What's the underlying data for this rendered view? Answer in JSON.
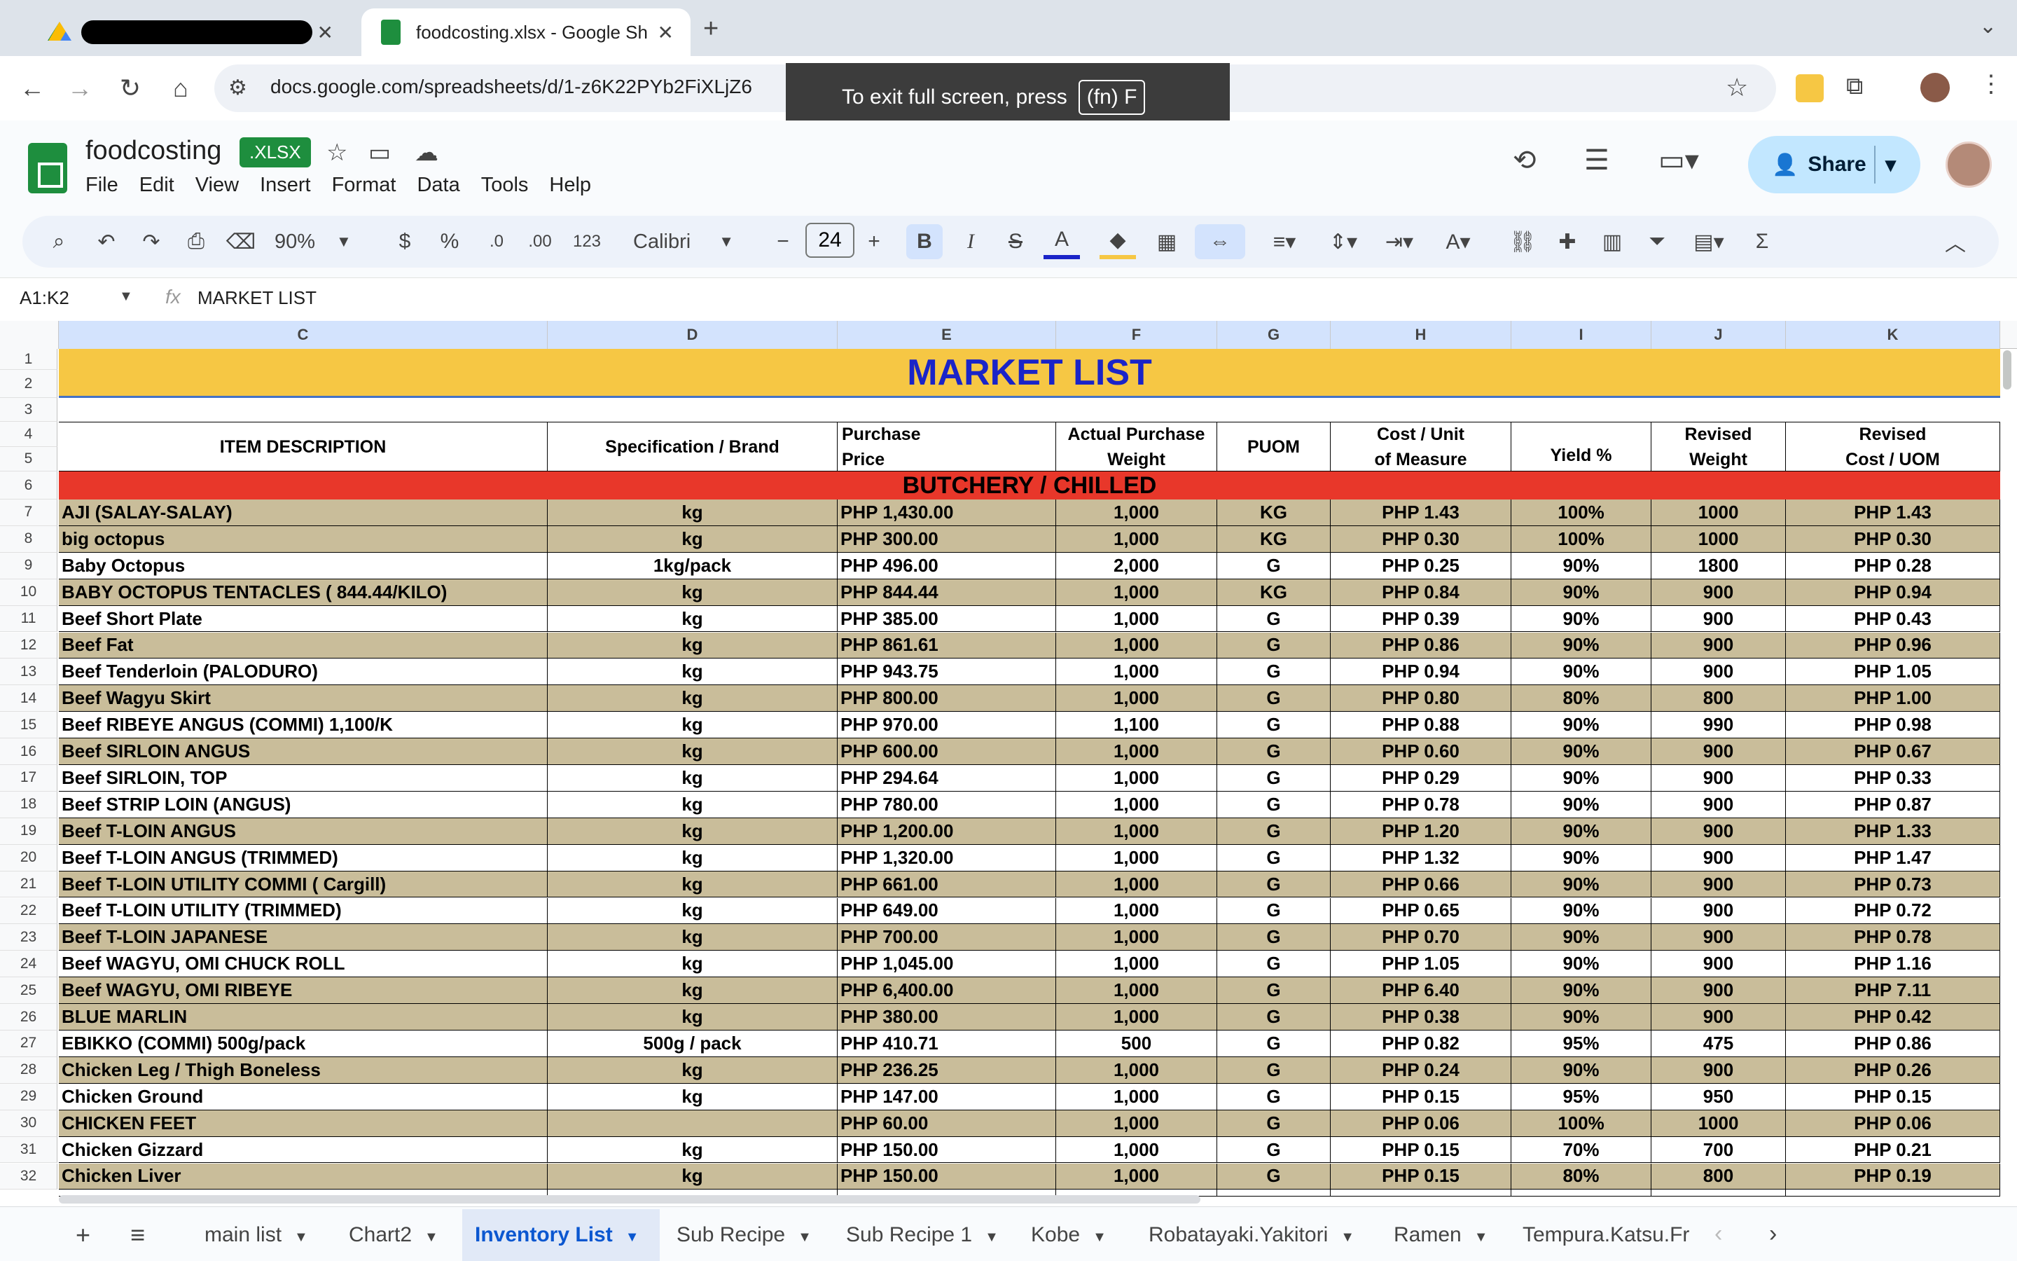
{
  "browser": {
    "tabs": [
      {
        "label": "",
        "redacted": true
      },
      {
        "label": "foodcosting.xlsx - Google Sh"
      }
    ],
    "url": "docs.google.com/spreadsheets/d/1-z6K22PYb2FiXLjZ6",
    "fullscreen_toast": {
      "text": "To exit full screen, press",
      "key": "(fn) F"
    }
  },
  "doc": {
    "title": "foodcosting",
    "badge": ".XLSX",
    "menu": [
      "File",
      "Edit",
      "View",
      "Insert",
      "Format",
      "Data",
      "Tools",
      "Help"
    ],
    "share_label": "Share"
  },
  "toolbar": {
    "zoom": "90%",
    "currency": "$",
    "percent": "%",
    "dec_decrease": ".0",
    "dec_increase": ".00",
    "number_format": "123",
    "font": "Calibri",
    "font_size": "24",
    "minus": "−",
    "plus": "+",
    "bold": "B",
    "italic": "I",
    "strike": "S",
    "textcolor": "A"
  },
  "formula_bar": {
    "namebox": "A1:K2",
    "fx": "fx",
    "content": "MARKET LIST"
  },
  "columns": [
    "C",
    "D",
    "E",
    "F",
    "G",
    "H",
    "I",
    "J",
    "K"
  ],
  "rows_visible": [
    "1",
    "2",
    "3",
    "4",
    "5",
    "6",
    "7",
    "8",
    "9",
    "10",
    "11",
    "12",
    "13",
    "14",
    "15",
    "16",
    "17",
    "18",
    "19",
    "20",
    "21",
    "22",
    "23",
    "24",
    "25",
    "26",
    "27",
    "28",
    "29",
    "30",
    "31",
    "32"
  ],
  "sheet": {
    "title": "MARKET LIST",
    "section": "BUTCHERY / CHILLED",
    "headers": {
      "c": "ITEM DESCRIPTION",
      "d": "Specification / Brand",
      "e1": "Purchase",
      "e2": "Price",
      "f1": "Actual Purchase",
      "f2": "Weight",
      "g": "PUOM",
      "h1": "Cost / Unit",
      "h2": "of Measure",
      "i": "Yield %",
      "j1": "Revised",
      "j2": "Weight",
      "k1": "Revised",
      "k2": "Cost / UOM"
    },
    "items": [
      {
        "row": "7",
        "desc": "AJI (SALAY-SALAY)",
        "spec": "kg",
        "price": "PHP 1,430.00",
        "weight": "1,000",
        "puom": "KG",
        "cost": "PHP 1.43",
        "yield": "100%",
        "rweight": "1000",
        "rcost": "PHP 1.43",
        "tan": true
      },
      {
        "row": "8",
        "desc": " big octopus",
        "spec": "kg",
        "price": "PHP 300.00",
        "weight": "1,000",
        "puom": "KG",
        "cost": "PHP 0.30",
        "yield": "100%",
        "rweight": "1000",
        "rcost": "PHP 0.30",
        "tan": true
      },
      {
        "row": "9",
        "desc": "Baby Octopus",
        "spec": "1kg/pack",
        "price": "PHP 496.00",
        "weight": "2,000",
        "puom": "G",
        "cost": "PHP 0.25",
        "yield": "90%",
        "rweight": "1800",
        "rcost": "PHP 0.28",
        "tan": false
      },
      {
        "row": "10",
        "desc": "BABY OCTOPUS  TENTACLES ( 844.44/KILO)",
        "spec": "kg",
        "price": "PHP 844.44",
        "weight": "1,000",
        "puom": "KG",
        "cost": "PHP 0.84",
        "yield": "90%",
        "rweight": "900",
        "rcost": "PHP 0.94",
        "tan": true
      },
      {
        "row": "11",
        "desc": "Beef Short Plate",
        "spec": "kg",
        "price": "PHP 385.00",
        "weight": "1,000",
        "puom": "G",
        "cost": "PHP 0.39",
        "yield": "90%",
        "rweight": "900",
        "rcost": "PHP 0.43",
        "tan": false
      },
      {
        "row": "12",
        "desc": "Beef Fat",
        "spec": "kg",
        "price": "PHP 861.61",
        "weight": "1,000",
        "puom": "G",
        "cost": "PHP 0.86",
        "yield": "90%",
        "rweight": "900",
        "rcost": "PHP 0.96",
        "tan": true
      },
      {
        "row": "13",
        "desc": "Beef Tenderloin (PALODURO)",
        "spec": "kg",
        "price": "PHP 943.75",
        "weight": "1,000",
        "puom": "G",
        "cost": "PHP 0.94",
        "yield": "90%",
        "rweight": "900",
        "rcost": "PHP 1.05",
        "tan": false
      },
      {
        "row": "14",
        "desc": "Beef Wagyu Skirt",
        "spec": "kg",
        "price": "PHP 800.00",
        "weight": "1,000",
        "puom": "G",
        "cost": "PHP 0.80",
        "yield": "80%",
        "rweight": "800",
        "rcost": "PHP 1.00",
        "tan": true
      },
      {
        "row": "15",
        "desc": "Beef RIBEYE ANGUS (COMMI) 1,100/K",
        "spec": "kg",
        "price": "PHP 970.00",
        "weight": "1,100",
        "puom": "G",
        "cost": "PHP 0.88",
        "yield": "90%",
        "rweight": "990",
        "rcost": "PHP 0.98",
        "tan": false
      },
      {
        "row": "16",
        "desc": "Beef SIRLOIN ANGUS",
        "spec": "kg",
        "price": "PHP 600.00",
        "weight": "1,000",
        "puom": "G",
        "cost": "PHP 0.60",
        "yield": "90%",
        "rweight": "900",
        "rcost": "PHP 0.67",
        "tan": true
      },
      {
        "row": "17",
        "desc": "Beef SIRLOIN, TOP",
        "spec": "kg",
        "price": "PHP 294.64",
        "weight": "1,000",
        "puom": "G",
        "cost": "PHP 0.29",
        "yield": "90%",
        "rweight": "900",
        "rcost": "PHP 0.33",
        "tan": false
      },
      {
        "row": "18",
        "desc": "Beef STRIP LOIN  (ANGUS)",
        "spec": "kg",
        "price": "PHP 780.00",
        "weight": "1,000",
        "puom": "G",
        "cost": "PHP 0.78",
        "yield": "90%",
        "rweight": "900",
        "rcost": "PHP 0.87",
        "tan": false
      },
      {
        "row": "19",
        "desc": "Beef T-LOIN ANGUS",
        "spec": "kg",
        "price": "PHP 1,200.00",
        "weight": "1,000",
        "puom": "G",
        "cost": "PHP 1.20",
        "yield": "90%",
        "rweight": "900",
        "rcost": "PHP 1.33",
        "tan": true
      },
      {
        "row": "20",
        "desc": "Beef T-LOIN ANGUS (TRIMMED)",
        "spec": "kg",
        "price": "PHP 1,320.00",
        "weight": "1,000",
        "puom": "G",
        "cost": "PHP 1.32",
        "yield": "90%",
        "rweight": "900",
        "rcost": "PHP 1.47",
        "tan": false
      },
      {
        "row": "21",
        "desc": "Beef T-LOIN UTILITY COMMI ( Cargill)",
        "spec": "kg",
        "price": "PHP 661.00",
        "weight": "1,000",
        "puom": "G",
        "cost": "PHP 0.66",
        "yield": "90%",
        "rweight": "900",
        "rcost": "PHP 0.73",
        "tan": true
      },
      {
        "row": "22",
        "desc": "Beef T-LOIN UTILITY (TRIMMED)",
        "spec": "kg",
        "price": "PHP 649.00",
        "weight": "1,000",
        "puom": "G",
        "cost": "PHP 0.65",
        "yield": "90%",
        "rweight": "900",
        "rcost": "PHP 0.72",
        "tan": false
      },
      {
        "row": "23",
        "desc": "Beef T-LOIN JAPANESE",
        "spec": "kg",
        "price": "PHP 700.00",
        "weight": "1,000",
        "puom": "G",
        "cost": "PHP 0.70",
        "yield": "90%",
        "rweight": "900",
        "rcost": "PHP 0.78",
        "tan": true
      },
      {
        "row": "24",
        "desc": "Beef WAGYU, OMI CHUCK ROLL",
        "spec": "kg",
        "price": "PHP 1,045.00",
        "weight": "1,000",
        "puom": "G",
        "cost": "PHP 1.05",
        "yield": "90%",
        "rweight": "900",
        "rcost": "PHP 1.16",
        "tan": false
      },
      {
        "row": "25",
        "desc": "Beef WAGYU, OMI RIBEYE",
        "spec": "kg",
        "price": "PHP 6,400.00",
        "weight": "1,000",
        "puom": "G",
        "cost": "PHP 6.40",
        "yield": "90%",
        "rweight": "900",
        "rcost": "PHP 7.11",
        "tan": true
      },
      {
        "row": "26",
        "desc": "BLUE MARLIN",
        "spec": "kg",
        "price": "PHP 380.00",
        "weight": "1,000",
        "puom": "G",
        "cost": "PHP 0.38",
        "yield": "90%",
        "rweight": "900",
        "rcost": "PHP 0.42",
        "tan": true
      },
      {
        "row": "27",
        "desc": "EBIKKO (COMMI) 500g/pack",
        "spec": "500g / pack",
        "price": "PHP 410.71",
        "weight": "500",
        "puom": "G",
        "cost": "PHP 0.82",
        "yield": "95%",
        "rweight": "475",
        "rcost": "PHP 0.86",
        "tan": false
      },
      {
        "row": "28",
        "desc": "Chicken Leg / Thigh Boneless",
        "spec": "kg",
        "price": "PHP 236.25",
        "weight": "1,000",
        "puom": "G",
        "cost": "PHP 0.24",
        "yield": "90%",
        "rweight": "900",
        "rcost": "PHP 0.26",
        "tan": true
      },
      {
        "row": "29",
        "desc": "Chicken Ground",
        "spec": "kg",
        "price": "PHP 147.00",
        "weight": "1,000",
        "puom": "G",
        "cost": "PHP 0.15",
        "yield": "95%",
        "rweight": "950",
        "rcost": "PHP 0.15",
        "tan": false
      },
      {
        "row": "30",
        "desc": "CHICKEN FEET",
        "spec": "",
        "price": "PHP 60.00",
        "weight": "1,000",
        "puom": "G",
        "cost": "PHP 0.06",
        "yield": "100%",
        "rweight": "1000",
        "rcost": "PHP 0.06",
        "tan": true
      },
      {
        "row": "31",
        "desc": "Chicken Gizzard",
        "spec": "kg",
        "price": "PHP 150.00",
        "weight": "1,000",
        "puom": "G",
        "cost": "PHP 0.15",
        "yield": "70%",
        "rweight": "700",
        "rcost": "PHP 0.21",
        "tan": false
      },
      {
        "row": "32",
        "desc": "Chicken Liver",
        "spec": "kg",
        "price": "PHP 150.00",
        "weight": "1,000",
        "puom": "G",
        "cost": "PHP 0.15",
        "yield": "80%",
        "rweight": "800",
        "rcost": "PHP 0.19",
        "tan": true
      }
    ]
  },
  "sheet_tabs": [
    "main list",
    "Chart2",
    "Inventory List",
    "Sub Recipe",
    "Sub Recipe 1",
    "Kobe",
    "Robatayaki.Yakitori",
    "Ramen",
    "Tempura.Katsu.Fr"
  ],
  "active_sheet": "Inventory List",
  "colors": {
    "title_bg": "#f6c744",
    "title_text": "#1a24c8",
    "section_bg": "#e8372a",
    "tan_row": "#c9bd9a",
    "accent": "#1e8e3e"
  }
}
